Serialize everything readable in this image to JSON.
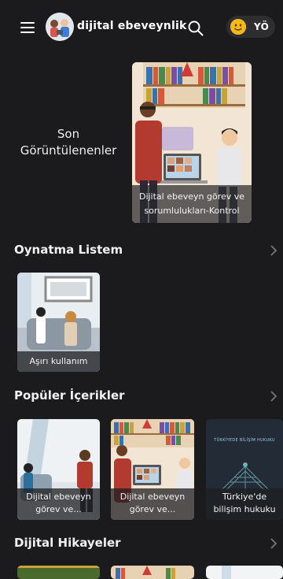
{
  "header": {
    "brand": "dijital ebeveynlik",
    "user_initials": "YÖ"
  },
  "recent": {
    "label_line1": "Son",
    "label_line2": "Görüntülenenler",
    "card_caption": "Dijital ebeveyn görev ve sorumlulukları-Kontrol"
  },
  "playlist": {
    "title": "Oynatma Listem",
    "items": [
      {
        "caption": "Aşırı kullanım"
      }
    ]
  },
  "popular": {
    "title": "Popüler İçerikler",
    "items": [
      {
        "caption": "Dijital ebeveyn görev ve..."
      },
      {
        "caption": "Dijital ebeveyn görev ve..."
      },
      {
        "caption": "Türkiye'de bilişim hukuku",
        "thumb_text": "TÜRKİYEDE BİLİŞİM HUKUKU"
      }
    ]
  },
  "stories": {
    "title": "Dijital Hikayeler"
  },
  "colors": {
    "background": "#1b1b1d",
    "pill": "#2e2e31",
    "emoji": "#f5b81a"
  },
  "icons": [
    "menu-icon",
    "search-icon",
    "smiley-icon",
    "chevron-right-icon"
  ]
}
